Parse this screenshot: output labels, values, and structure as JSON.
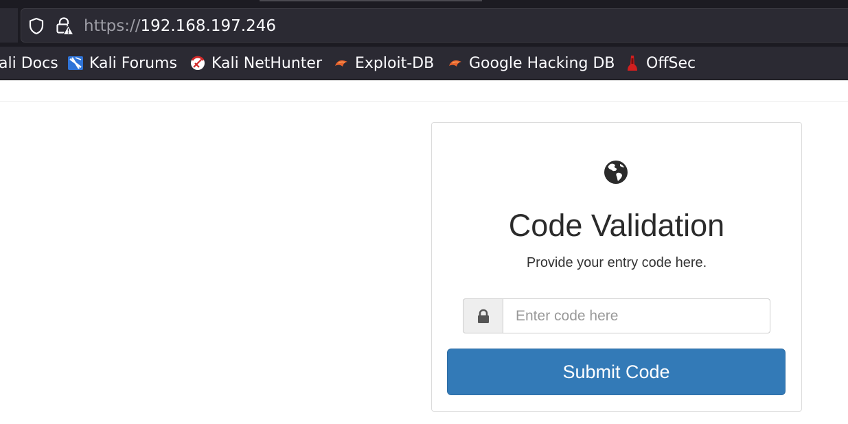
{
  "browser": {
    "url_scheme": "https://",
    "url_host": "192.168.197.246",
    "bookmarks": [
      {
        "label": "ali Docs",
        "icon": "kali-docs-icon"
      },
      {
        "label": "Kali Forums",
        "icon": "kali-forums-icon"
      },
      {
        "label": "Kali NetHunter",
        "icon": "kali-nethunter-icon"
      },
      {
        "label": "Exploit-DB",
        "icon": "exploit-db-icon"
      },
      {
        "label": "Google Hacking DB",
        "icon": "google-hacking-db-icon"
      },
      {
        "label": "OffSec",
        "icon": "offsec-icon"
      }
    ]
  },
  "form": {
    "icon": "globe-icon",
    "title": "Code Validation",
    "subtitle": "Provide your entry code here.",
    "input_placeholder": "Enter code here",
    "input_value": "",
    "submit_label": "Submit Code"
  },
  "colors": {
    "primary_button": "#337ab7",
    "chrome_dark": "#1c1b22",
    "toolbar": "#2b2a33"
  }
}
